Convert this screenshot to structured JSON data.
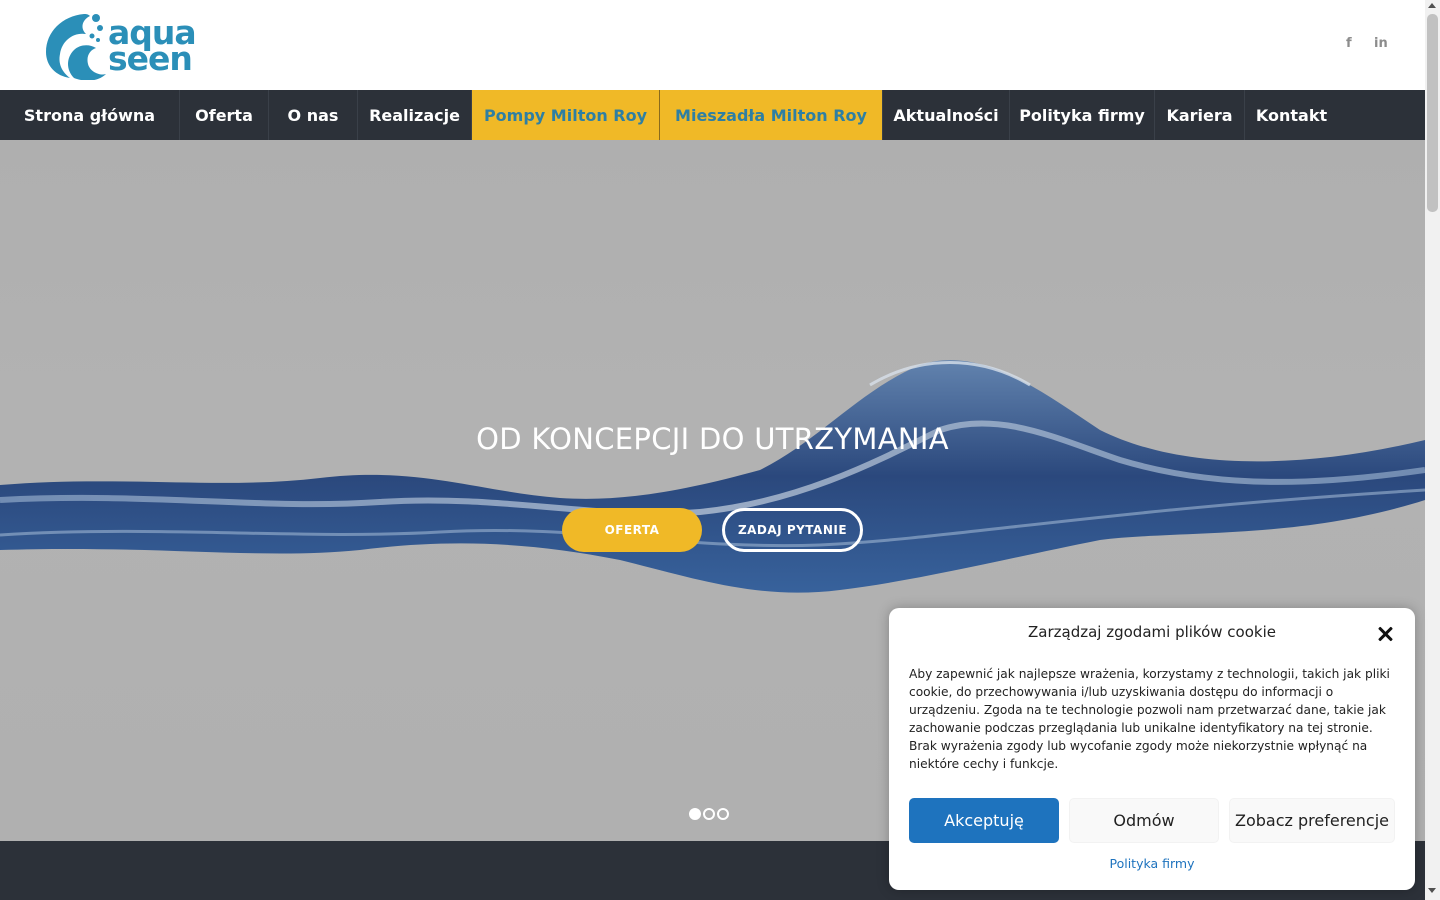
{
  "header": {
    "logo": {
      "line1": "aqua",
      "line2": "seen"
    },
    "social": {
      "facebook": "f",
      "linkedin": "in"
    }
  },
  "nav": {
    "items": [
      {
        "label": "Strona główna",
        "highlight": false
      },
      {
        "label": "Oferta",
        "highlight": false
      },
      {
        "label": "O nas",
        "highlight": false
      },
      {
        "label": "Realizacje",
        "highlight": false
      },
      {
        "label": "Pompy Milton Roy",
        "highlight": true
      },
      {
        "label": "Mieszadła Milton Roy",
        "highlight": true
      },
      {
        "label": "Aktualności",
        "highlight": false
      },
      {
        "label": "Polityka firmy",
        "highlight": false
      },
      {
        "label": "Kariera",
        "highlight": false
      },
      {
        "label": "Kontakt",
        "highlight": false
      }
    ]
  },
  "hero": {
    "title": "OD KONCEPCJI DO UTRZYMANIA",
    "primary_button": "OFERTA",
    "secondary_button": "ZADAJ PYTANIE",
    "slides": 3,
    "active_slide": 1
  },
  "cookie": {
    "title": "Zarządzaj zgodami plików cookie",
    "body": "Aby zapewnić jak najlepsze wrażenia, korzystamy z technologii, takich jak pliki cookie, do przechowywania i/lub uzyskiwania dostępu do informacji o urządzeniu. Zgoda na te technologie pozwoli nam przetwarzać dane, takie jak zachowanie podczas przeglądania lub unikalne identyfikatory na tej stronie. Brak wyrażenia zgody lub wycofanie zgody może niekorzystnie wpłynąć na niektóre cechy i funkcje.",
    "accept": "Akceptuję",
    "deny": "Odmów",
    "preferences": "Zobacz preferencje",
    "policy_link": "Polityka firmy"
  },
  "colors": {
    "nav_bg": "#2c3139",
    "accent_yellow": "#f0b927",
    "brand_blue": "#2b8fb8",
    "button_blue": "#1e73be"
  }
}
